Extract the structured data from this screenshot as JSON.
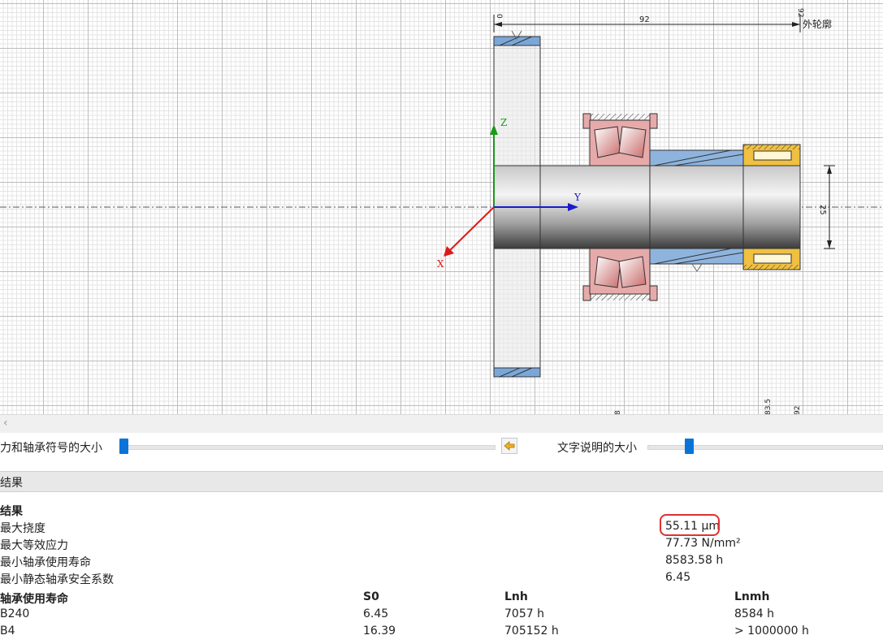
{
  "drawing": {
    "dim_top": "92",
    "dim_top_left": "0",
    "dim_top_right": "92",
    "outer_contour_label": "外轮廓",
    "dim_right": "25",
    "axis_z": "Z",
    "axis_y": "Y",
    "axis_x": "X",
    "bottom_label_1": "8",
    "bottom_label_2": "83.5",
    "bottom_label_3": "92",
    "colors": {
      "z_axis": "#1a9a1a",
      "y_axis": "#1a1acc",
      "x_axis": "#dd1a1a",
      "gear": "#6fa0d6",
      "bearing_pink": "#e7aaaa",
      "bearing_yellow": "#f0c040"
    }
  },
  "sliders": {
    "force_label": "力和轴承符号的大小",
    "text_label": "文字说明的大小",
    "reset_icon": "reset-arrow-icon"
  },
  "results": {
    "header": "结果",
    "section_title": "结果",
    "items": [
      {
        "label": "最大挠度",
        "value": "55.11 µm"
      },
      {
        "label": "最大等效应力",
        "value": "77.73 N/mm²"
      },
      {
        "label": "最小轴承使用寿命",
        "value": "8583.58 h"
      },
      {
        "label": "最小静态轴承安全系数",
        "value": "6.45"
      }
    ],
    "bearing_table": {
      "title": "轴承使用寿命",
      "columns": [
        "S0",
        "Lnh",
        "Lnmh"
      ],
      "rows": [
        {
          "name": "B240",
          "s0": "6.45",
          "lnh": "7057 h",
          "lnmh": "8584 h"
        },
        {
          "name": "B4",
          "s0": "16.39",
          "lnh": "705152 h",
          "lnmh": "> 1000000 h"
        }
      ]
    }
  }
}
